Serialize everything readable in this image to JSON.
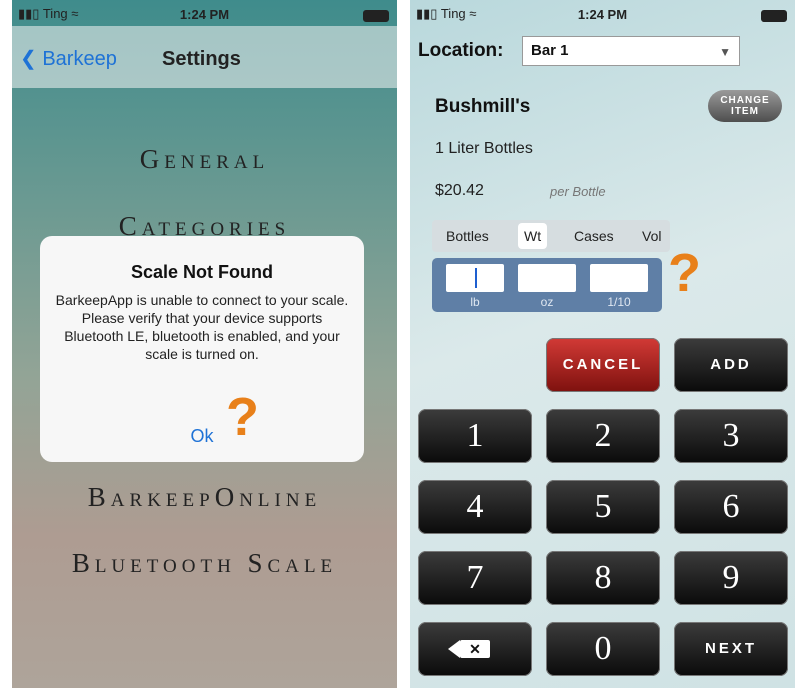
{
  "left": {
    "status": {
      "carrier": "Ting",
      "time": "1:24 PM"
    },
    "nav": {
      "back_label": "Barkeep",
      "title": "Settings"
    },
    "menu": [
      "General",
      "Categories",
      "BarkeepOnline",
      "Bluetooth Scale"
    ],
    "alert": {
      "title": "Scale Not Found",
      "message": "BarkeepApp is unable to connect to your scale.  Please verify that your device supports Bluetooth LE, bluetooth is enabled, and your scale is turned on.",
      "ok_label": "Ok"
    },
    "question_mark": "?"
  },
  "right": {
    "status": {
      "carrier": "Ting",
      "time": "1:24 PM"
    },
    "location": {
      "label": "Location:",
      "value": "Bar 1"
    },
    "item": {
      "name": "Bushmill's",
      "size": "1 Liter Bottles",
      "price": "$20.42",
      "price_unit": "per Bottle"
    },
    "change_item_label": "CHANGE ITEM",
    "modes": [
      "Bottles",
      "Wt",
      "Cases",
      "Vol"
    ],
    "selected_mode": "Wt",
    "weight_units": [
      "lb",
      "oz",
      "1/10"
    ],
    "question_mark": "?",
    "actions": {
      "cancel": "CANCEL",
      "add": "ADD",
      "next": "NEXT"
    },
    "keypad": [
      "1",
      "2",
      "3",
      "4",
      "5",
      "6",
      "7",
      "8",
      "9",
      "0"
    ]
  },
  "colors": {
    "accent_blue": "#1e72d6",
    "question_orange": "#e8801a",
    "cancel_red": "#b1221f"
  }
}
